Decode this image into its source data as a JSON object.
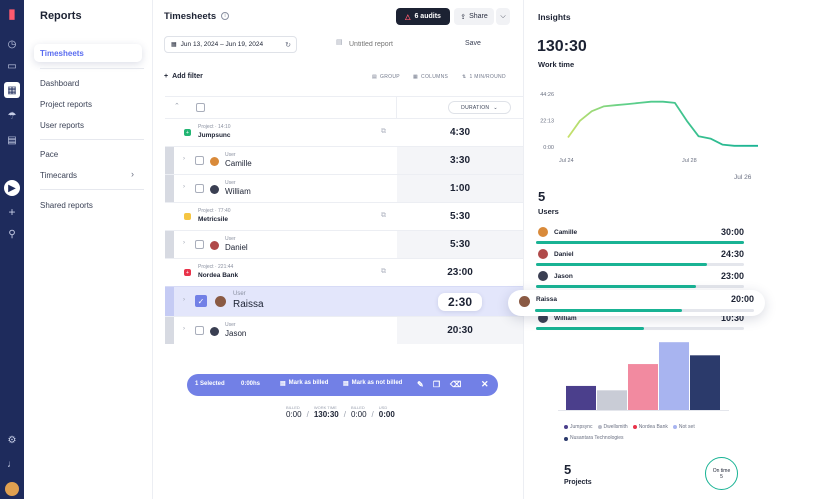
{
  "sidebar": {
    "title": "Reports",
    "items": [
      {
        "label": "Timesheets",
        "active": true
      },
      {
        "label": "Dashboard"
      },
      {
        "label": "Project reports"
      },
      {
        "label": "User reports"
      },
      {
        "label": "Pace"
      },
      {
        "label": "Timecards"
      },
      {
        "label": "Shared reports"
      }
    ]
  },
  "main": {
    "title": "Timesheets",
    "audits_label": "6 audits",
    "share_label": "Share",
    "date_range": "Jun 13, 2024 – Jun 19, 2024",
    "report_name_placeholder": "Untitled report",
    "save_label": "Save",
    "add_filter_label": "Add filter",
    "group_label": "GROUP",
    "columns_label": "COLUMNS",
    "rounding_label": "1 MIN/ROUND",
    "duration_header": "DURATION",
    "rows": [
      {
        "kind": "project",
        "label": "Project · 14:10",
        "name": "Jumpsunc",
        "duration": "4:30",
        "color": "#22b573",
        "glyph": "+"
      },
      {
        "kind": "user",
        "label": "User",
        "name": "Camille",
        "duration": "3:30",
        "avatar_color": "#d98a3a"
      },
      {
        "kind": "user",
        "label": "User",
        "name": "William",
        "duration": "1:00",
        "avatar_color": "#3a3f52"
      },
      {
        "kind": "project",
        "label": "Project · 77:40",
        "name": "Metricsile",
        "duration": "5:30",
        "color": "#f5c542",
        "glyph": ""
      },
      {
        "kind": "user",
        "label": "User",
        "name": "Daniel",
        "duration": "5:30",
        "avatar_color": "#b04a4a"
      },
      {
        "kind": "project",
        "label": "Project · 221:44",
        "name": "Nordea Bank",
        "duration": "23:00",
        "color": "#e8334a",
        "glyph": "+"
      },
      {
        "kind": "user",
        "label": "User",
        "name": "Raissa",
        "duration": "2:30",
        "avatar_color": "#8a5a44",
        "selected": true
      },
      {
        "kind": "user",
        "label": "User",
        "name": "Jason",
        "duration": "20:30",
        "avatar_color": "#3a3f52"
      }
    ],
    "selection_bar": {
      "selected": "1 Selected",
      "hours": "0:00hs",
      "mark_billed": "Mark as billed",
      "mark_not_billed": "Mark as not billed"
    },
    "totals": [
      {
        "label": "BILLED",
        "value": "0:00"
      },
      {
        "label": "WORK TIME",
        "value": "130:30"
      },
      {
        "label": "BILLED",
        "value": "0:00"
      },
      {
        "label": "USD",
        "value": "0:00"
      }
    ]
  },
  "insights": {
    "title": "Insights",
    "work_time_value": "130:30",
    "work_time_label": "Work time",
    "users_count": "5",
    "users_label": "Users",
    "projects_count": "5",
    "projects_label": "Projects",
    "on_time_label": "On time",
    "on_time_value": "5",
    "users": [
      {
        "name": "Camille",
        "value": "30:00",
        "fraction": 1.0,
        "avatar_color": "#d98a3a"
      },
      {
        "name": "Daniel",
        "value": "24:30",
        "fraction": 0.82,
        "avatar_color": "#b04a4a"
      },
      {
        "name": "Jason",
        "value": "23:00",
        "fraction": 0.77,
        "avatar_color": "#3a3f52"
      },
      {
        "name": "Raissa",
        "value": "20:00",
        "fraction": 0.67,
        "avatar_color": "#8a5a44",
        "highlight": true
      },
      {
        "name": "William",
        "value": "10:30",
        "fraction": 0.52,
        "avatar_color": "#3a3f52"
      }
    ],
    "legend": [
      {
        "name": "Jumpsync",
        "color": "#4b3f8c"
      },
      {
        "name": "Dwellsmith",
        "color": "#b9bcc8"
      },
      {
        "name": "Nordea Bank",
        "color": "#e8334a"
      },
      {
        "name": "Not set",
        "color": "#a8b4f0"
      },
      {
        "name": "Nusantara Technologies",
        "color": "#2b3a6b"
      }
    ]
  },
  "chart_data": [
    {
      "type": "line",
      "x_ticks": [
        "Jul 24",
        "Jul 28"
      ],
      "x_extra_label": "Jul 26",
      "y_ticks": [
        "0:00",
        "22:13",
        "44:26"
      ],
      "ylim": [
        0,
        44.43
      ],
      "points": [
        [
          0,
          8
        ],
        [
          1,
          22
        ],
        [
          2,
          30
        ],
        [
          3,
          34
        ],
        [
          4,
          35
        ],
        [
          5,
          36
        ],
        [
          6,
          37
        ],
        [
          7,
          38
        ],
        [
          8,
          38
        ],
        [
          9,
          37
        ],
        [
          10,
          22
        ],
        [
          11,
          9
        ],
        [
          12,
          7
        ],
        [
          13,
          2
        ],
        [
          14,
          1
        ],
        [
          15,
          1
        ],
        [
          16,
          1
        ]
      ],
      "grid": false
    },
    {
      "type": "bar",
      "categories": [
        "Jumpsync",
        "Dwellsmith",
        "Nordea Bank",
        "Not set",
        "Nusantara Technologies"
      ],
      "values": [
        22,
        18,
        42,
        62,
        50
      ],
      "colors": [
        "#4b3f8c",
        "#c9ccd6",
        "#f28aa0",
        "#a8b4f0",
        "#2b3a6b"
      ]
    }
  ]
}
